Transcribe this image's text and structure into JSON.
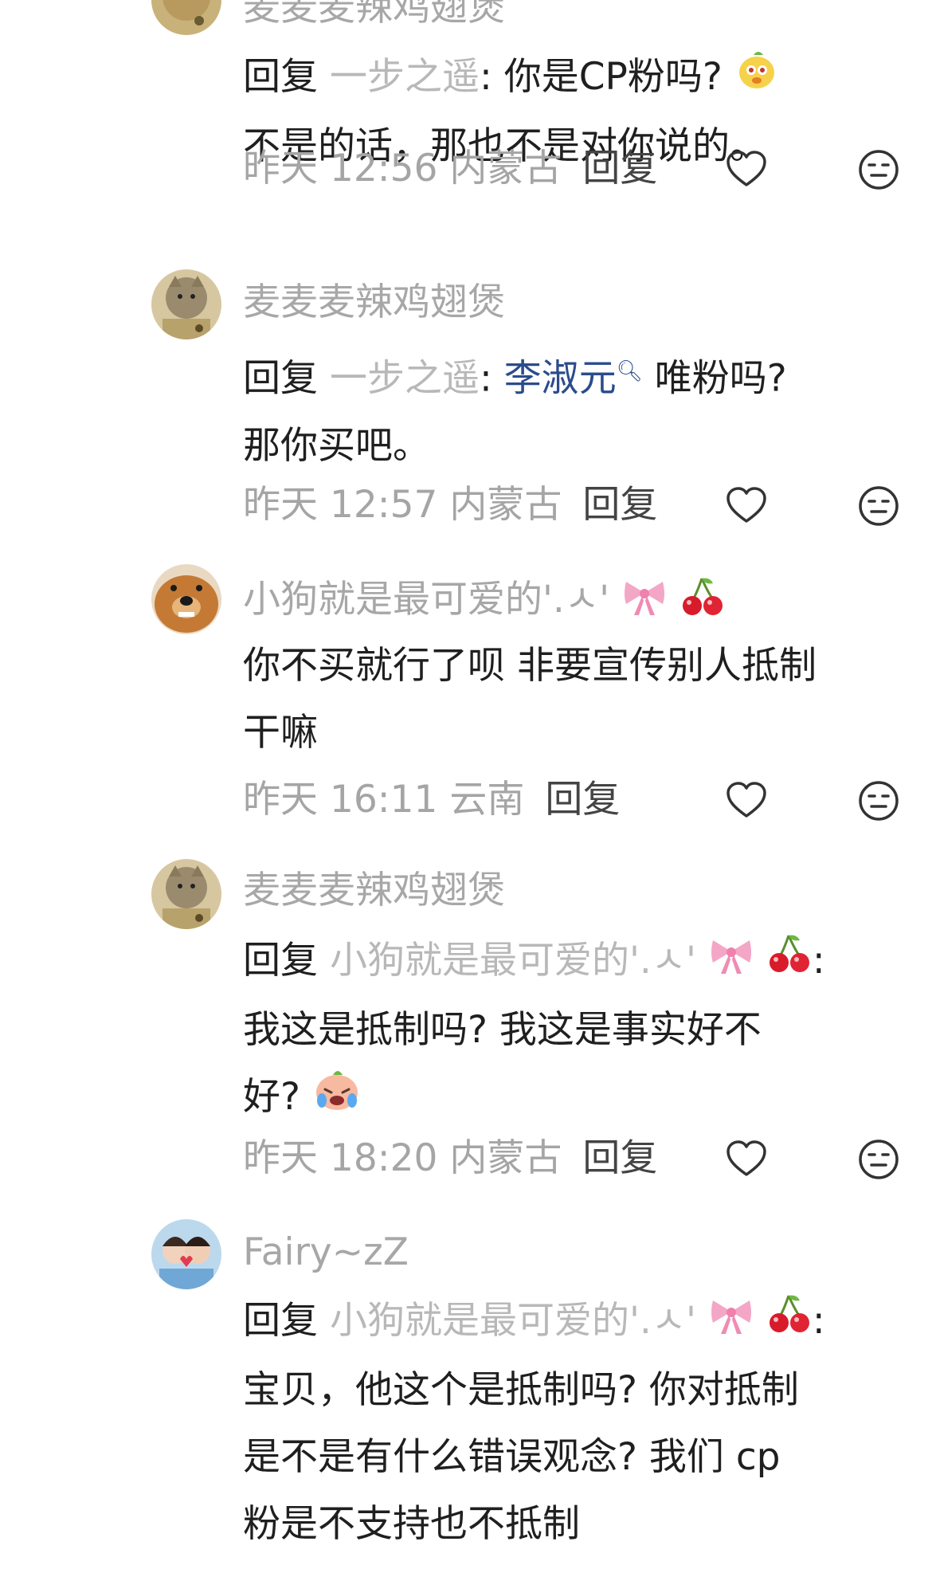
{
  "comments": [
    {
      "username": "麦麦麦辣鸡翅煲",
      "reply_prefix": "回复",
      "reply_target": "一步之遥",
      "text_line1": ": 你是CP粉吗?",
      "text_line2": "不是的话，那也不是对你说的。",
      "meta_time": "昨天 12:56 内蒙古",
      "reply_label": "回复"
    },
    {
      "username": "麦麦麦辣鸡翅煲",
      "reply_prefix": "回复",
      "reply_target": "一步之遥",
      "colon": ":",
      "mention": "李淑元",
      "text_after_mention": " 唯粉吗?",
      "text_line2": "那你买吧。",
      "meta_time": "昨天 12:57 内蒙古",
      "reply_label": "回复"
    },
    {
      "username": "小狗就是最可爱的'.ㅅ'",
      "text_line1": "你不买就行了呗 非要宣传别人抵制",
      "text_line2": "干嘛",
      "meta_time": "昨天 16:11 云南",
      "reply_label": "回复"
    },
    {
      "username": "麦麦麦辣鸡翅煲",
      "reply_prefix": "回复",
      "reply_target": "小狗就是最可爱的'.ㅅ'",
      "colon": ":",
      "text_line2": "我这是抵制吗? 我这是事实好不",
      "text_line3": "好?",
      "meta_time": "昨天 18:20 内蒙古",
      "reply_label": "回复"
    },
    {
      "username": "Fairy~zZ",
      "reply_prefix": "回复",
      "reply_target": "小狗就是最可爱的'.ㅅ'",
      "colon": ":",
      "text_line2": "宝贝，他这个是抵制吗? 你对抵制",
      "text_line3": "是不是有什么错误观念?  我们 cp",
      "text_line4": "粉是不支持也不抵制"
    }
  ],
  "icons": {
    "like": "heart-outline-icon",
    "react": "emoji-react-icon"
  },
  "colors": {
    "username": "#a7a7a7",
    "mention": "#2b4c8c",
    "text": "#1f1f1f"
  }
}
